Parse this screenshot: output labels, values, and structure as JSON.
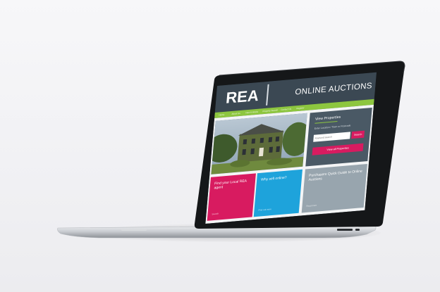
{
  "site": {
    "logo_text": "REA",
    "header_title": "ONLINE AUCTIONS",
    "nav_items": [
      "Home",
      "About Us",
      "How It Works",
      "Property Search",
      "Contact Us",
      "Register"
    ],
    "colors": {
      "header_bg": "#3b4853",
      "nav_green": "#8dc63f",
      "accent_pink": "#d81b60",
      "accent_blue": "#1ea3db",
      "panel_grey": "#4a5965",
      "tile_grey": "#98a5ae"
    }
  },
  "search_panel": {
    "title": "View Properties",
    "subtitle": "Enter Location / Town or Postcode",
    "input_placeholder": "Keyword search",
    "search_button": "Search",
    "view_all_button": "View all Properties"
  },
  "tiles": [
    {
      "title": "Find your Local REA agent",
      "link": "Search"
    },
    {
      "title": "Why sell online?",
      "link": "Find out more"
    },
    {
      "title": "Purchasers Quick Guide to Online Auctions",
      "link": "Read more"
    }
  ],
  "icons": {
    "hero_image": "house-photo"
  }
}
